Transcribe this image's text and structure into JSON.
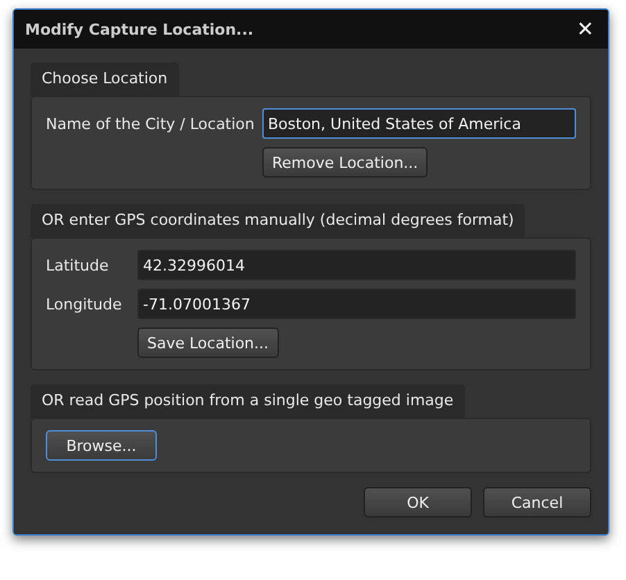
{
  "window": {
    "title": "Modify Capture Location...",
    "close": "✕"
  },
  "sections": [
    {
      "title": "Choose Location",
      "kind": "city",
      "label": "Name of the City / Location",
      "value": "Boston, United States of America",
      "focused": true,
      "button": "Remove Location..."
    },
    {
      "title": "OR enter GPS coordinates manually (decimal degrees format)",
      "kind": "coords",
      "fields": [
        {
          "label": "Latitude",
          "value": "42.32996014"
        },
        {
          "label": "Longitude",
          "value": "-71.07001367"
        }
      ],
      "button": "Save Location..."
    },
    {
      "title": "OR read GPS position from a single geo tagged image",
      "kind": "browse",
      "button": "Browse...",
      "focused": true
    }
  ],
  "buttons": [
    "OK",
    "Cancel"
  ]
}
